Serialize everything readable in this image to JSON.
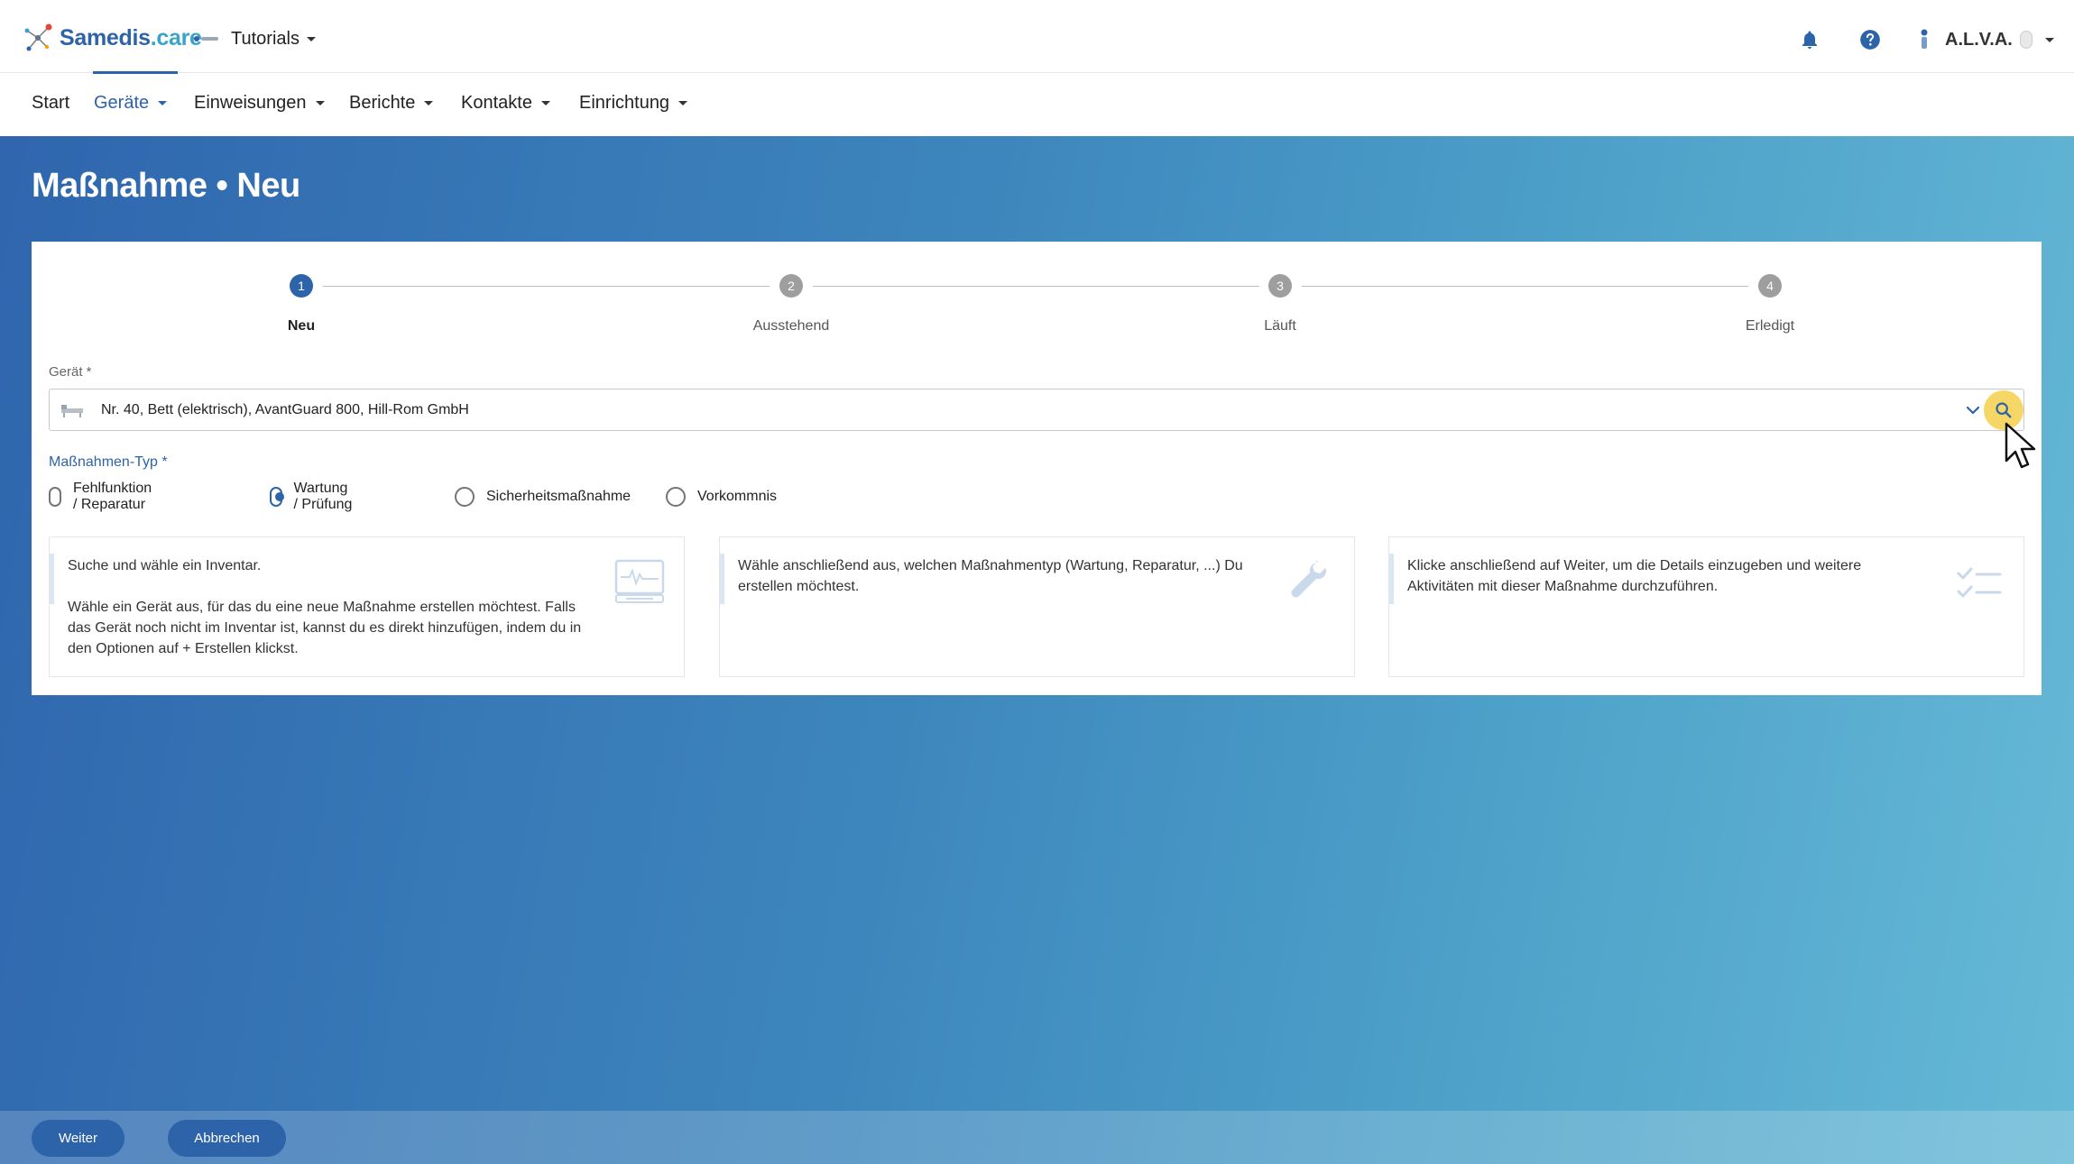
{
  "header": {
    "logo_text_main": "Samedis",
    "logo_text_suffix": ".care",
    "tenant": "Tutorials",
    "user": "A.L.V.A."
  },
  "nav": {
    "items": [
      {
        "label": "Start"
      },
      {
        "label": "Geräte"
      },
      {
        "label": "Einweisungen"
      },
      {
        "label": "Berichte"
      },
      {
        "label": "Kontakte"
      },
      {
        "label": "Einrichtung"
      }
    ],
    "active": "Geräte"
  },
  "page": {
    "title": "Maßnahme • Neu"
  },
  "stepper": {
    "steps": [
      {
        "number": "1",
        "label": "Neu",
        "active": true
      },
      {
        "number": "2",
        "label": "Ausstehend",
        "active": false
      },
      {
        "number": "3",
        "label": "Läuft",
        "active": false
      },
      {
        "number": "4",
        "label": "Erledigt",
        "active": false
      }
    ]
  },
  "form": {
    "device_label": "Gerät *",
    "device_value": "Nr. 40, Bett (elektrisch), AvantGuard 800, Hill-Rom GmbH",
    "type_label": "Maßnahmen-Typ *",
    "type_options": [
      {
        "label": "Fehlfunktion / Reparatur",
        "checked": false
      },
      {
        "label": "Wartung / Prüfung",
        "checked": true
      },
      {
        "label": "Sicherheitsmaßnahme",
        "checked": false
      },
      {
        "label": "Vorkommnis",
        "checked": false
      }
    ]
  },
  "info": [
    {
      "paragraphs": [
        "Suche und wähle ein Inventar.",
        "Wähle ein Gerät aus, für das du eine neue Maßnahme erstellen möchtest. Falls das Gerät noch nicht im Inventar ist, kannst du es direkt hinzufügen, indem du in den Optionen auf + Erstellen klickst."
      ],
      "icon": "monitor-icon"
    },
    {
      "paragraphs": [
        "Wähle anschließend aus, welchen Maßnahmentyp (Wartung, Reparatur, ...) Du erstellen möchtest."
      ],
      "icon": "wrench-icon"
    },
    {
      "paragraphs": [
        "Klicke anschließend auf Weiter, um die Details einzugeben und weitere Aktivitäten mit dieser Maßnahme durchzuführen."
      ],
      "icon": "checklist-icon"
    }
  ],
  "footer": {
    "next_label": "Weiter",
    "cancel_label": "Abbrechen"
  },
  "colors": {
    "primary": "#2d63a8",
    "highlight": "#f6d766"
  }
}
